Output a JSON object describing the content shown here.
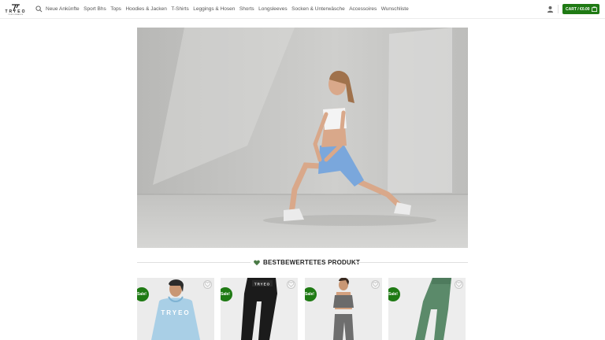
{
  "brand": {
    "logo_text": "TRYEO",
    "logo_subtext": "PERFORMANCE"
  },
  "nav": {
    "items": [
      "Neue Ankünfte",
      "Sport Bhs",
      "Tops",
      "Hoodies & Jacken",
      "T-Shirts",
      "Leggings & Hosen",
      "Shorts",
      "Longsleeves",
      "Socken & Unterwäsche",
      "Accessoires",
      "Wunschliste"
    ]
  },
  "cart": {
    "label": "CART / €0.00"
  },
  "section": {
    "title": "BESTBEWERTETES PRODUKT"
  },
  "products": [
    {
      "badge": "Sale!"
    },
    {
      "badge": "Sale!"
    },
    {
      "badge": "Sale!"
    },
    {
      "badge": "Sale!"
    }
  ],
  "colors": {
    "accent": "#1f7a14",
    "heart": "#4a7a46"
  },
  "icons": {
    "search": "search-icon",
    "user": "user-icon",
    "cart": "cart-icon",
    "wishlist": "heart-outline-icon",
    "section": "heart-icon"
  }
}
